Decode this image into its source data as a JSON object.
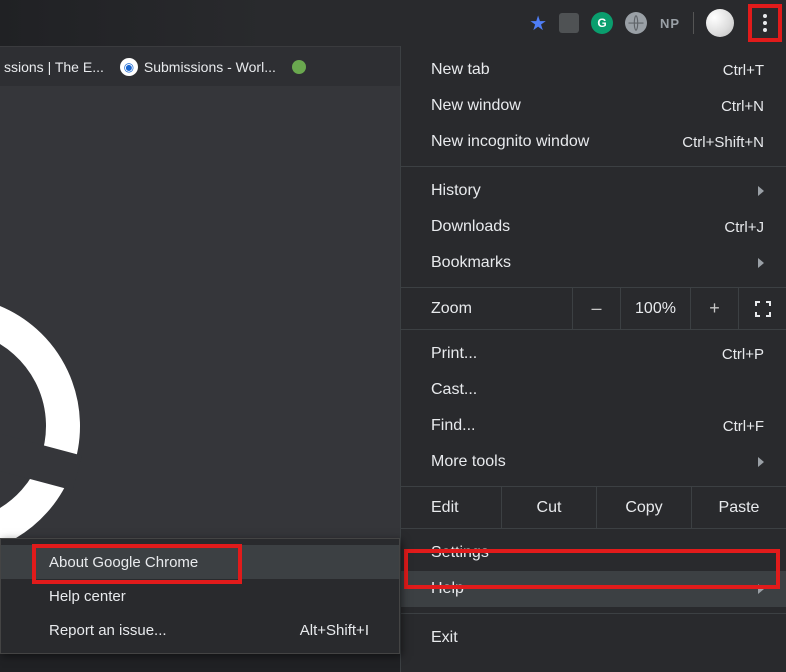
{
  "toolbar": {
    "extensions": {
      "grammarly_letter": "G",
      "np_text": "NP"
    }
  },
  "bookmarks": {
    "item1": "ssions | The E...",
    "item2": "Submissions - Worl..."
  },
  "menu": {
    "new_tab": "New tab",
    "new_tab_key": "Ctrl+T",
    "new_window": "New window",
    "new_window_key": "Ctrl+N",
    "incognito": "New incognito window",
    "incognito_key": "Ctrl+Shift+N",
    "history": "History",
    "downloads": "Downloads",
    "downloads_key": "Ctrl+J",
    "bookmarks": "Bookmarks",
    "zoom_label": "Zoom",
    "zoom_minus": "–",
    "zoom_value": "100%",
    "zoom_plus": "+",
    "print": "Print...",
    "print_key": "Ctrl+P",
    "cast": "Cast...",
    "find": "Find...",
    "find_key": "Ctrl+F",
    "more_tools": "More tools",
    "edit": "Edit",
    "cut": "Cut",
    "copy": "Copy",
    "paste": "Paste",
    "settings": "Settings",
    "help": "Help",
    "exit": "Exit"
  },
  "submenu": {
    "about": "About Google Chrome",
    "help_center": "Help center",
    "report": "Report an issue...",
    "report_key": "Alt+Shift+I"
  }
}
